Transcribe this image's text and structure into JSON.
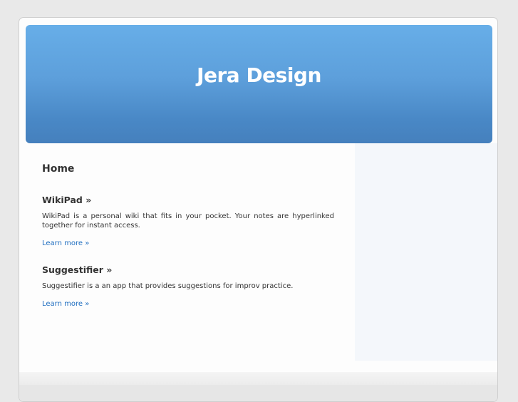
{
  "header": {
    "site_title": "Jera Design"
  },
  "main": {
    "page_title": "Home",
    "entries": [
      {
        "title": "WikiPad »",
        "description": "WikiPad is a personal wiki that fits in your pocket. Your notes are hyperlinked together for instant access.",
        "link_label": "Learn more »"
      },
      {
        "title": "Suggestifier »",
        "description": "Suggestifier is a an app that provides suggestions for improv practice.",
        "link_label": "Learn more »"
      }
    ]
  },
  "colors": {
    "header_top": "#67aee8",
    "header_bottom": "#4580bd",
    "link": "#1f6ec0",
    "text": "#333333",
    "sidebar_bg": "#f4f7fb"
  }
}
